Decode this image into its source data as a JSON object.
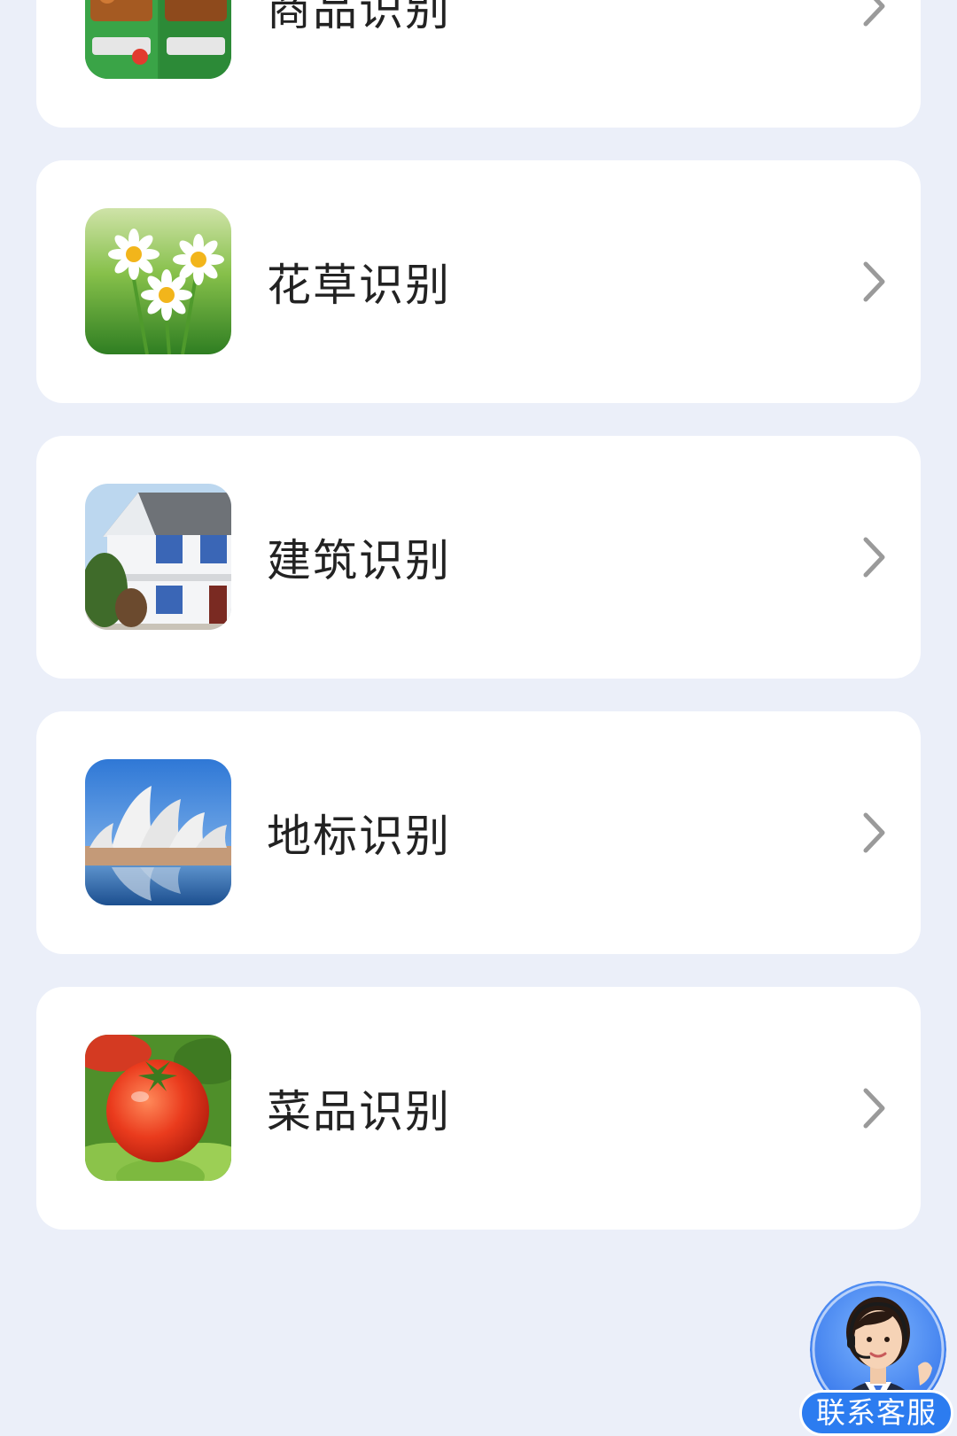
{
  "items": [
    {
      "label": "商品识别",
      "icon": "goods-image",
      "chevron": "chevron-right-icon"
    },
    {
      "label": "花草识别",
      "icon": "flower-image",
      "chevron": "chevron-right-icon"
    },
    {
      "label": "建筑识别",
      "icon": "building-image",
      "chevron": "chevron-right-icon"
    },
    {
      "label": "地标识别",
      "icon": "landmark-image",
      "chevron": "chevron-right-icon"
    },
    {
      "label": "菜品识别",
      "icon": "dish-image",
      "chevron": "chevron-right-icon"
    }
  ],
  "support_button": {
    "label": "联系客服",
    "icon": "customer-service-avatar-icon"
  },
  "colors": {
    "page_background": "#ebeff9",
    "card_background": "#ffffff",
    "text": "#222222",
    "chevron": "#9a9a9a",
    "support_badge": "#2c7cf0"
  }
}
